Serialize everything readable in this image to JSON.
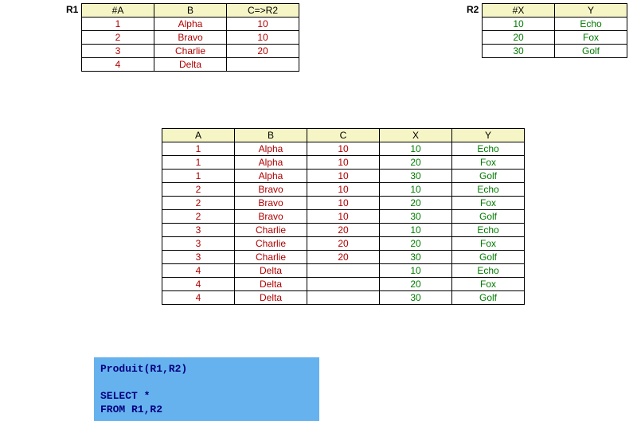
{
  "labels": {
    "r1": "R1",
    "r2": "R2"
  },
  "r1": {
    "headers": [
      "#A",
      "B",
      "C=>R2"
    ],
    "rows": [
      [
        "1",
        "Alpha",
        "10"
      ],
      [
        "2",
        "Bravo",
        "10"
      ],
      [
        "3",
        "Charlie",
        "20"
      ],
      [
        "4",
        "Delta",
        ""
      ]
    ]
  },
  "r2": {
    "headers": [
      "#X",
      "Y"
    ],
    "rows": [
      [
        "10",
        "Echo"
      ],
      [
        "20",
        "Fox"
      ],
      [
        "30",
        "Golf"
      ]
    ]
  },
  "product": {
    "headers": [
      "A",
      "B",
      "C",
      "X",
      "Y"
    ],
    "rows": [
      [
        "1",
        "Alpha",
        "10",
        "10",
        "Echo"
      ],
      [
        "1",
        "Alpha",
        "10",
        "20",
        "Fox"
      ],
      [
        "1",
        "Alpha",
        "10",
        "30",
        "Golf"
      ],
      [
        "2",
        "Bravo",
        "10",
        "10",
        "Echo"
      ],
      [
        "2",
        "Bravo",
        "10",
        "20",
        "Fox"
      ],
      [
        "2",
        "Bravo",
        "10",
        "30",
        "Golf"
      ],
      [
        "3",
        "Charlie",
        "20",
        "10",
        "Echo"
      ],
      [
        "3",
        "Charlie",
        "20",
        "20",
        "Fox"
      ],
      [
        "3",
        "Charlie",
        "20",
        "30",
        "Golf"
      ],
      [
        "4",
        "Delta",
        "",
        "10",
        "Echo"
      ],
      [
        "4",
        "Delta",
        "",
        "20",
        "Fox"
      ],
      [
        "4",
        "Delta",
        "",
        "30",
        "Golf"
      ]
    ]
  },
  "code": {
    "line1": "Produit(R1,R2)",
    "line2": "",
    "line3": "SELECT *",
    "line4": "FROM R1,R2"
  }
}
